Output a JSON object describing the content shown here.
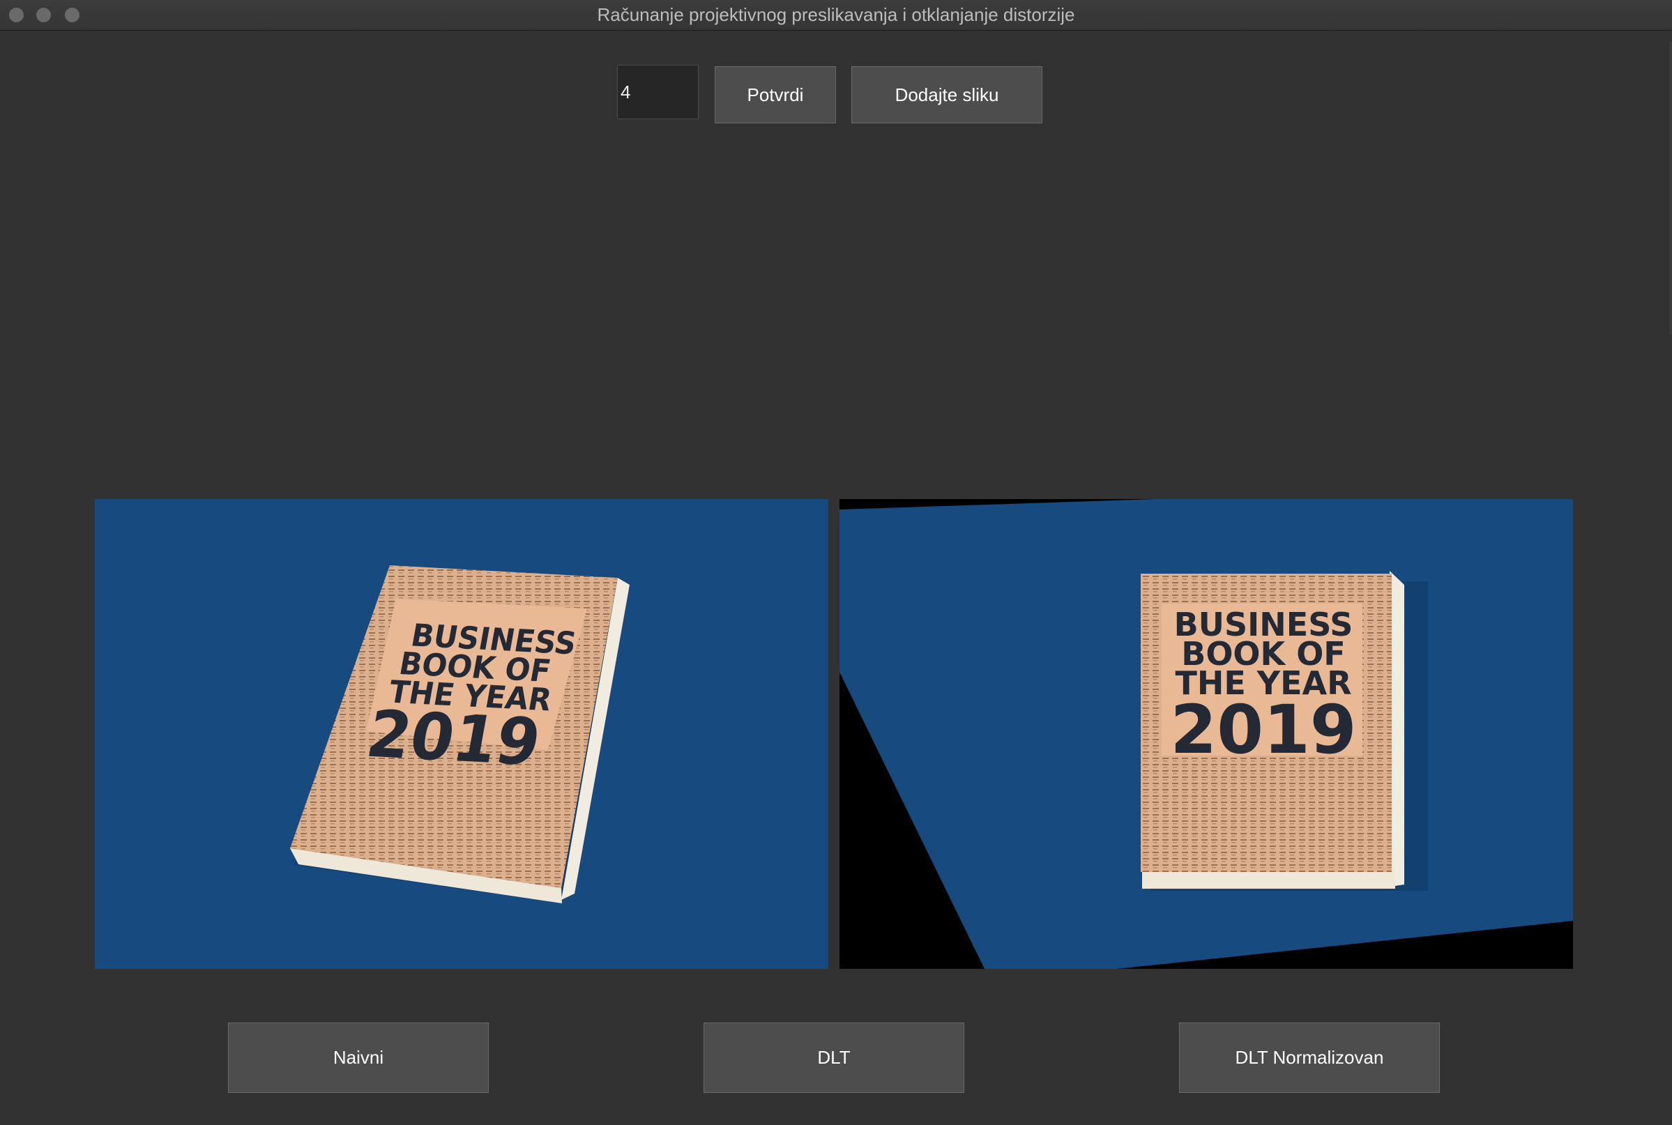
{
  "window": {
    "title": "Računanje projektivnog preslikavanja i otklanjanje distorzije"
  },
  "toolbar": {
    "points_input_value": "4",
    "confirm_label": "Potvrdi",
    "add_image_label": "Dodajte sliku"
  },
  "images": {
    "book_line1": "BUSINESS",
    "book_line2": "BOOK OF",
    "book_line3": "THE YEAR",
    "book_line4": "2019",
    "background_color": "#174a7e",
    "cover_color": "#e9b895",
    "text_color": "#232a36"
  },
  "actions": {
    "naive_label": "Naivni",
    "dlt_label": "DLT",
    "dlt_normalized_label": "DLT Normalizovan"
  }
}
